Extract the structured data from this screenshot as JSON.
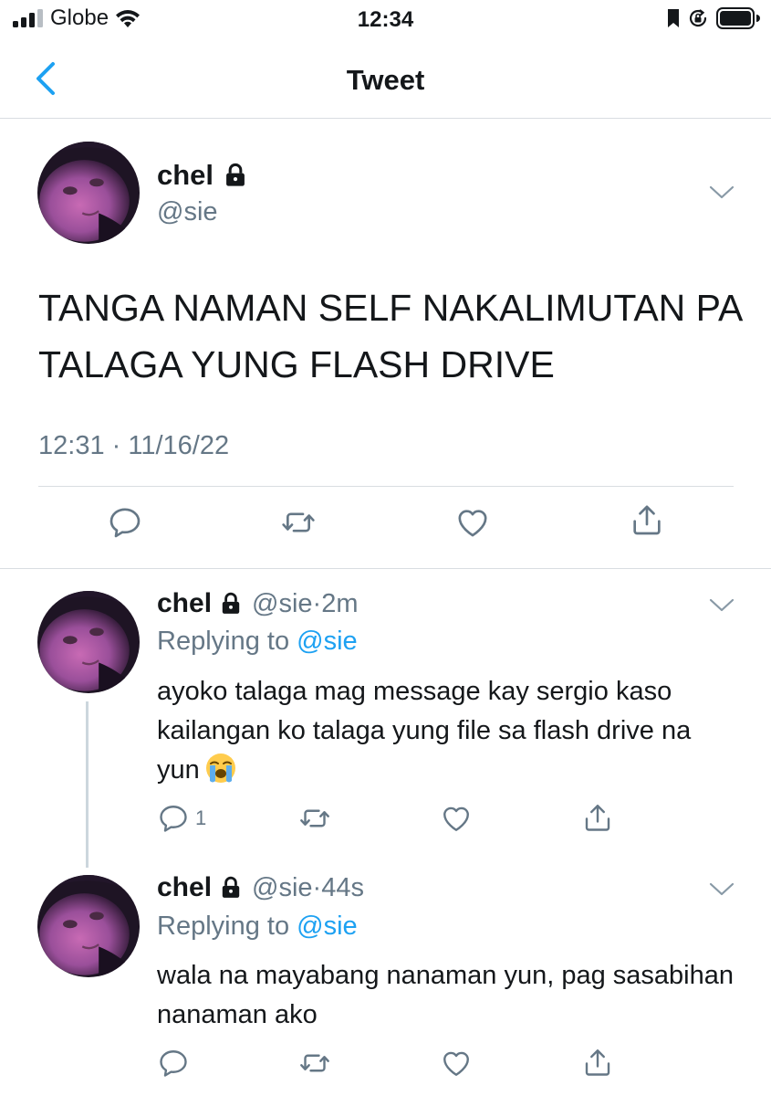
{
  "status_bar": {
    "carrier": "Globe",
    "time": "12:34",
    "signal_icon": "signal-bars-icon",
    "wifi_icon": "wifi-icon",
    "battery_icon": "battery-icon"
  },
  "nav": {
    "title": "Tweet",
    "back_icon": "back-chevron-icon"
  },
  "colors": {
    "accent": "#1da1f2",
    "secondary_text": "#657786",
    "divider": "#d9dde1"
  },
  "main_tweet": {
    "name": "chel",
    "handle": "@sie",
    "text": "TANGA NAMAN SELF NAKALIMUTAN PA TALAGA YUNG FLASH DRIVE",
    "timestamp": "12:31 · 11/16/22",
    "actions": [
      "reply-icon",
      "retweet-icon",
      "like-icon",
      "share-icon"
    ]
  },
  "replies": [
    {
      "name": "chel",
      "handle": "@sie",
      "sep": " · ",
      "time": "2m",
      "replying_label": "Replying to ",
      "replying_to": "@sie",
      "text": "ayoko talaga mag message kay sergio kaso kailangan ko talaga yung file sa flash drive na yun",
      "emoji": "loudly-crying-face-emoji",
      "reply_count": "1"
    },
    {
      "name": "chel",
      "handle": "@sie",
      "sep": " · ",
      "time": "44s",
      "replying_label": "Replying to ",
      "replying_to": "@sie",
      "text": "wala na mayabang nanaman yun, pag sasabihan nanaman ako"
    }
  ]
}
